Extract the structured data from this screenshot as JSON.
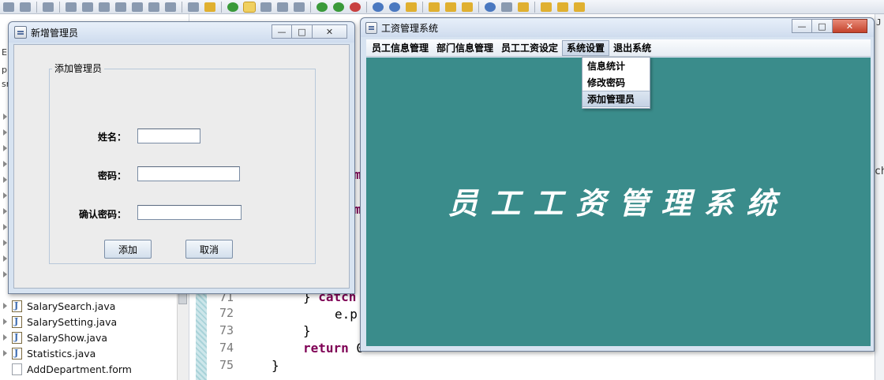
{
  "ide": {
    "tree_files": [
      {
        "name": "SalarySearch.java",
        "type": "java"
      },
      {
        "name": "SalarySetting.java",
        "type": "java"
      },
      {
        "name": "SalaryShow.java",
        "type": "java"
      },
      {
        "name": "Statistics.java",
        "type": "java"
      },
      {
        "name": "AddDepartment.form",
        "type": "form"
      }
    ],
    "left_fragments": [
      "E",
      "pl",
      "sr"
    ],
    "line_numbers": [
      "71",
      "72",
      "73",
      "74",
      "75"
    ],
    "code": {
      "line71_brace": "} ",
      "line71_kw": "catch",
      "line72": "e.p",
      "line73": "}",
      "line74_kw": "return",
      "line74_rest": " 0",
      "line75": "}"
    },
    "edge_fragments": {
      "m1": "m",
      "m2": "m",
      "ch": "ch",
      "j": "J"
    }
  },
  "dialog": {
    "title": "新增管理员",
    "group_title": "添加管理员",
    "labels": {
      "name": "姓名：",
      "password": "密码：",
      "confirm": "确认密码："
    },
    "values": {
      "name": "",
      "password": "",
      "confirm": ""
    },
    "buttons": {
      "add": "添加",
      "cancel": "取消"
    },
    "controls": {
      "minimize": "—",
      "restore": "□",
      "close": "✕"
    }
  },
  "main_window": {
    "title": "工资管理系统",
    "menu": [
      "员工信息管理",
      "部门信息管理",
      "员工工资设定",
      "系统设置",
      "退出系统"
    ],
    "open_menu_index": 3,
    "dropdown_items": [
      "信息统计",
      "修改密码",
      "添加管理员"
    ],
    "hovered_dropdown_index": 2,
    "content_title": "员工工资管理系统",
    "background_color": "#3a8c8b",
    "controls": {
      "minimize": "—",
      "restore": "□",
      "close": "✕"
    }
  }
}
